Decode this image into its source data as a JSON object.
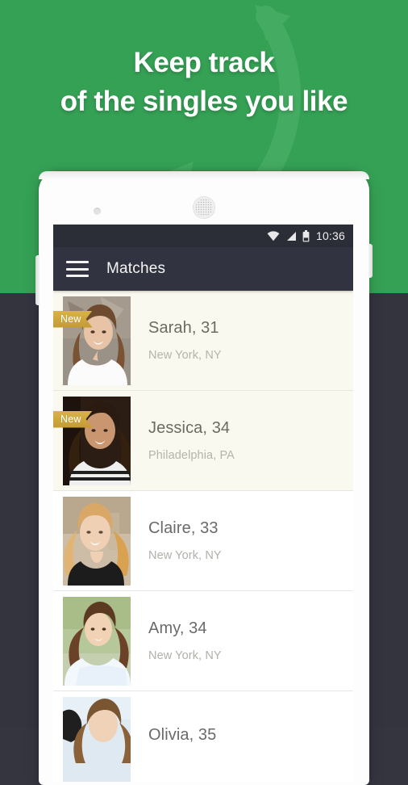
{
  "theme": {
    "green": "#35a155",
    "dark": "#33343e",
    "appbar": "#313440",
    "statusbar": "#2b2d37",
    "badge_gold": "#c49a34",
    "new_row_bg": "#faf9ef"
  },
  "promo": {
    "headline_line1": "Keep track",
    "headline_line2": "of the singles you like",
    "watermark_icon": "cupid-arrow-watermark"
  },
  "device": {
    "camera_icon": "front-camera-icon",
    "speaker_icon": "earpiece-speaker-icon",
    "volume_button": "volume-rocker",
    "power_button": "power-button"
  },
  "statusbar": {
    "wifi_icon": "wifi-icon",
    "signal_icon": "cell-signal-icon",
    "battery_icon": "battery-icon",
    "time": "10:36"
  },
  "appbar": {
    "menu_icon": "hamburger-menu-icon",
    "title": "Matches"
  },
  "matches": {
    "new_badge_label": "New",
    "items": [
      {
        "name": "Sarah, 31",
        "location": "New York, NY",
        "is_new": true,
        "photo": "portrait-sarah"
      },
      {
        "name": "Jessica, 34",
        "location": "Philadelphia, PA",
        "is_new": true,
        "photo": "portrait-jessica"
      },
      {
        "name": "Claire, 33",
        "location": "New York, NY",
        "is_new": false,
        "photo": "portrait-claire"
      },
      {
        "name": "Amy, 34",
        "location": "New York, NY",
        "is_new": false,
        "photo": "portrait-amy"
      },
      {
        "name": "Olivia, 35",
        "location": "",
        "is_new": false,
        "photo": "portrait-olivia"
      }
    ]
  }
}
